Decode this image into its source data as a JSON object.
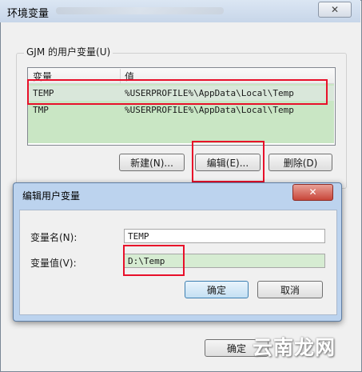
{
  "outer_window": {
    "title": "环境变量",
    "close_glyph": "✕"
  },
  "user_vars": {
    "group_label": "GJM 的用户变量(U)",
    "columns": [
      "变量",
      "值"
    ],
    "rows": [
      {
        "name": "TEMP",
        "value": "%USERPROFILE%\\AppData\\Local\\Temp"
      },
      {
        "name": "TMP",
        "value": "%USERPROFILE%\\AppData\\Local\\Temp"
      }
    ],
    "buttons": {
      "new": "新建(N)...",
      "edit": "编辑(E)...",
      "delete": "删除(D)"
    }
  },
  "dialog": {
    "title": "编辑用户变量",
    "close_glyph": "✕",
    "name_label": "变量名(N):",
    "name_value": "TEMP",
    "value_label": "变量值(V):",
    "value_value": "D:\\Temp",
    "ok": "确定",
    "cancel": "取消"
  },
  "outer_ok": "确定",
  "watermark": "云南龙网",
  "colors": {
    "highlight_red": "#e8102a",
    "list_green": "#c9e6c4",
    "dialog_frame": "#bcd3ee"
  }
}
